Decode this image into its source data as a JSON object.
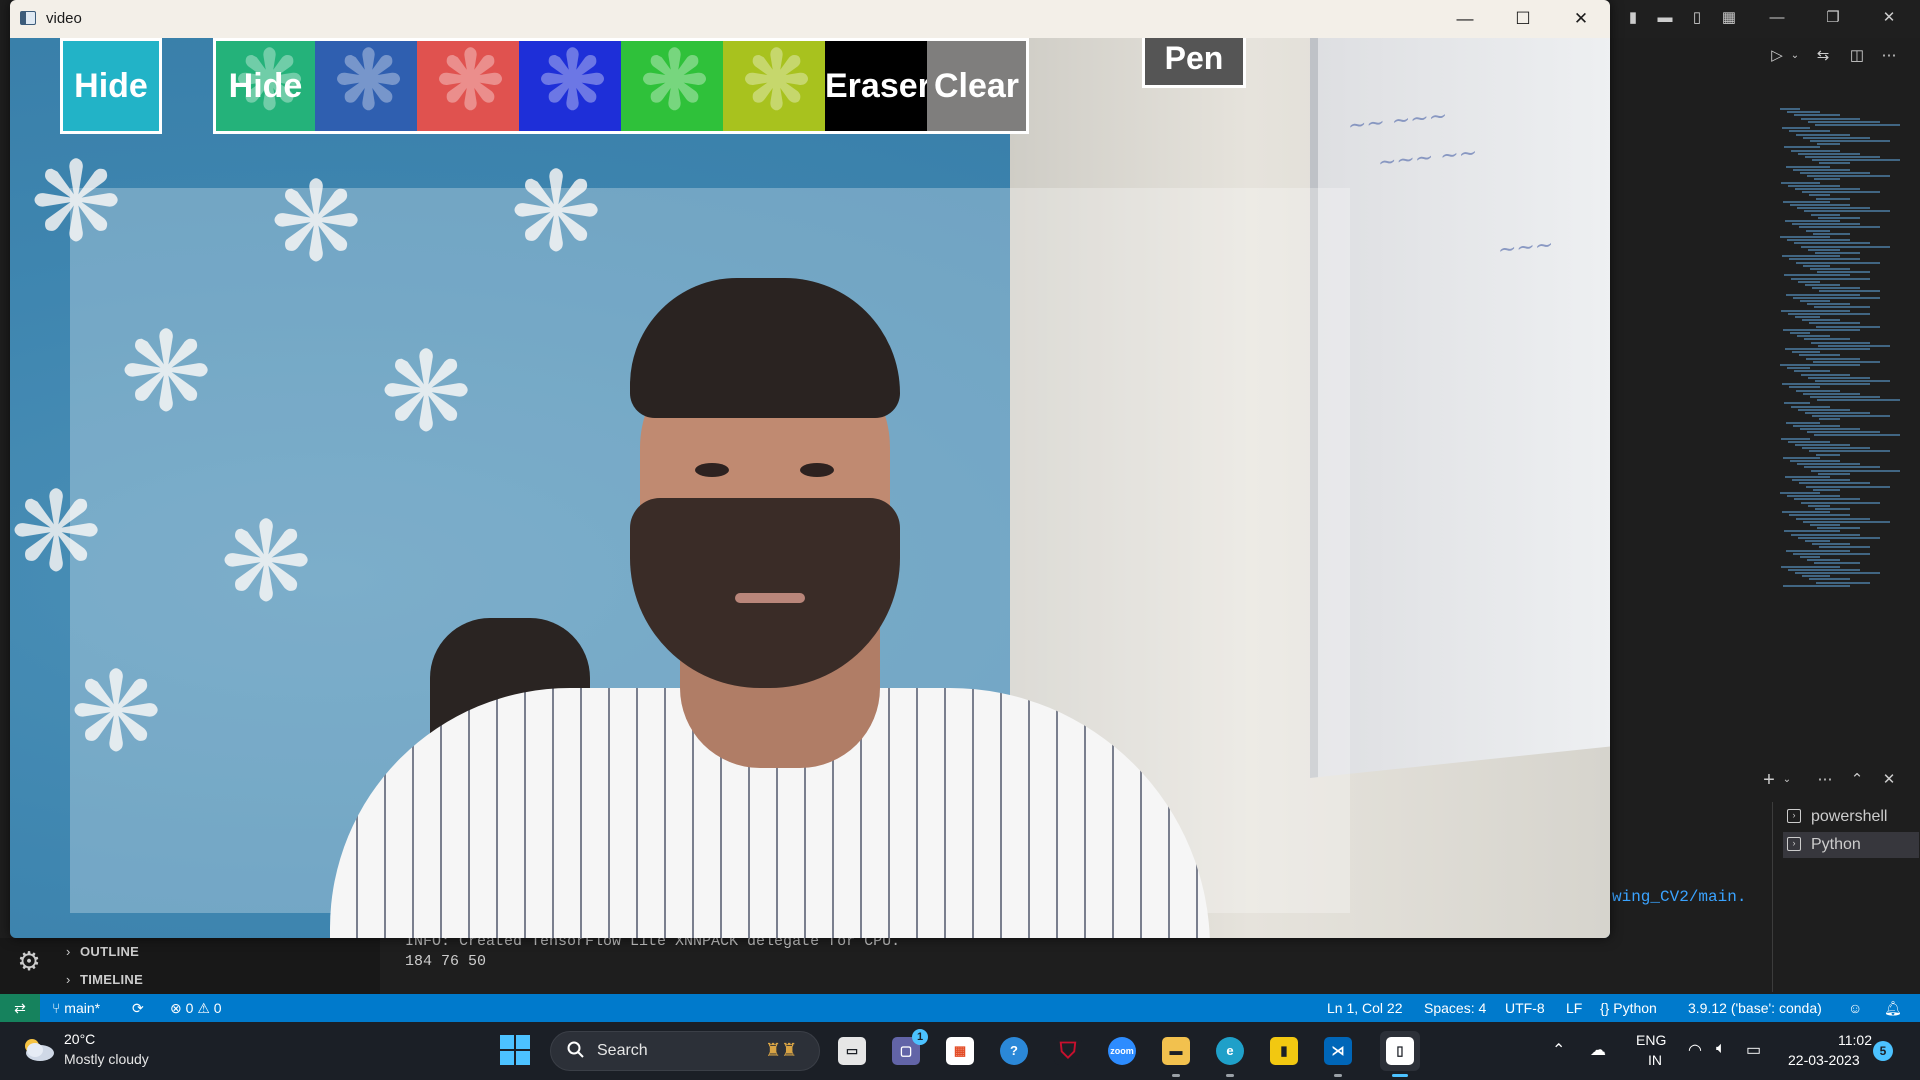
{
  "video_window": {
    "title": "video",
    "toolbar": {
      "buttons": [
        {
          "label": "Hide",
          "color": "#22b3c7"
        },
        {
          "label": "Hide",
          "color": "#24b27a"
        },
        {
          "label": "",
          "color": "#2f5fb0"
        },
        {
          "label": "",
          "color": "#e0524f"
        },
        {
          "label": "",
          "color": "#1e2fd8"
        },
        {
          "label": "",
          "color": "#2fc13a"
        },
        {
          "label": "",
          "color": "#a8c21e"
        },
        {
          "label": "Eraser",
          "color": "#000000"
        },
        {
          "label": "Clear",
          "color": "#7f7e7d"
        }
      ],
      "mode_label": "Pen"
    }
  },
  "terminal": {
    "profiles": [
      "powershell",
      "Python"
    ],
    "path_fragment": "wing_CV2/main.",
    "output_lines": [
      "INFO: Created TensorFlow Lite XNNPACK delegate for CPU.",
      "184 76 50"
    ]
  },
  "sidebar": {
    "sections": [
      "OUTLINE",
      "TIMELINE"
    ]
  },
  "statusbar": {
    "branch": "main*",
    "errors": "0",
    "warnings": "0",
    "position": "Ln 1, Col 22",
    "spaces": "Spaces: 4",
    "encoding": "UTF-8",
    "eol": "LF",
    "language": "Python",
    "interpreter": "3.9.12 ('base': conda)"
  },
  "taskbar": {
    "weather_temp": "20°C",
    "weather_desc": "Mostly cloudy",
    "search_label": "Search",
    "teams_badge": "1",
    "lang_line1": "ENG",
    "lang_line2": "IN",
    "time": "11:02",
    "date": "22-03-2023",
    "notifications": "5",
    "zoom_label": "zoom"
  },
  "colors": {
    "accent": "#007acc",
    "taskbar_bg": "#1b1f26"
  }
}
